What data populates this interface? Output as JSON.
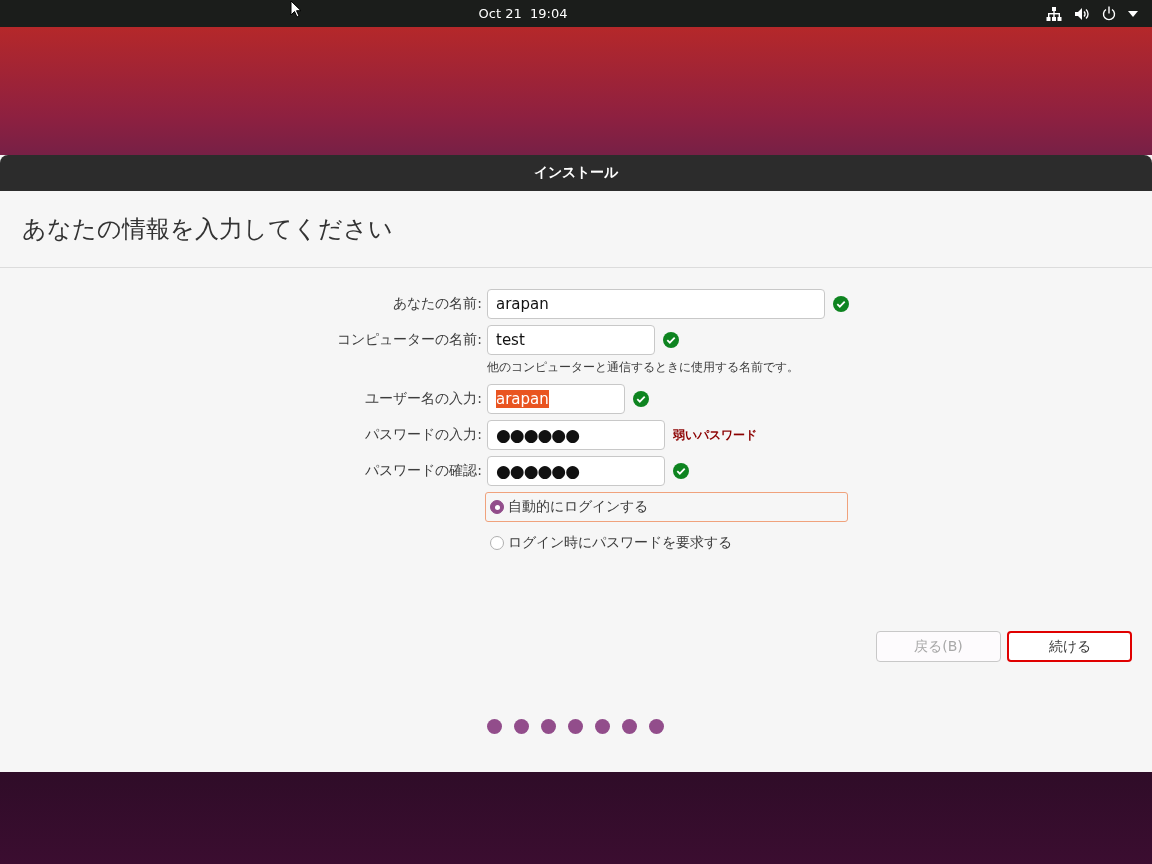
{
  "top_bar": {
    "clock": "Oct 21  19:04"
  },
  "window": {
    "title": "インストール"
  },
  "heading": "あなたの情報を入力してください",
  "fields": [
    {
      "label": "あなたの名前:",
      "value": "arapan",
      "kind": "text",
      "valid": true
    },
    {
      "label": "コンピューターの名前:",
      "value": "test",
      "kind": "text",
      "valid": true,
      "hint": "他のコンピューターと通信するときに使用する名前です。"
    },
    {
      "label": "ユーザー名の入力:",
      "value": "arapan",
      "kind": "text",
      "text_selected": true,
      "valid": true
    },
    {
      "label": "パスワードの入力:",
      "value": "●●●●●●",
      "kind": "password",
      "valid": false,
      "status_text": "弱いパスワード"
    },
    {
      "label": "パスワードの確認:",
      "value": "●●●●●●",
      "kind": "password",
      "valid": true
    }
  ],
  "login_options": [
    {
      "label": "自動的にログインする",
      "selected": true,
      "focused": true
    },
    {
      "label": "ログイン時にパスワードを要求する",
      "selected": false,
      "focused": false
    }
  ],
  "buttons": [
    {
      "label": "戻る(B)",
      "disabled": true,
      "highlighted": false
    },
    {
      "label": "続ける",
      "disabled": false,
      "highlighted": true
    }
  ],
  "progress_dots": [
    {
      "filled": true
    },
    {
      "filled": true
    },
    {
      "filled": true
    },
    {
      "filled": true
    },
    {
      "filled": true
    },
    {
      "filled": true
    },
    {
      "filled": true
    }
  ]
}
